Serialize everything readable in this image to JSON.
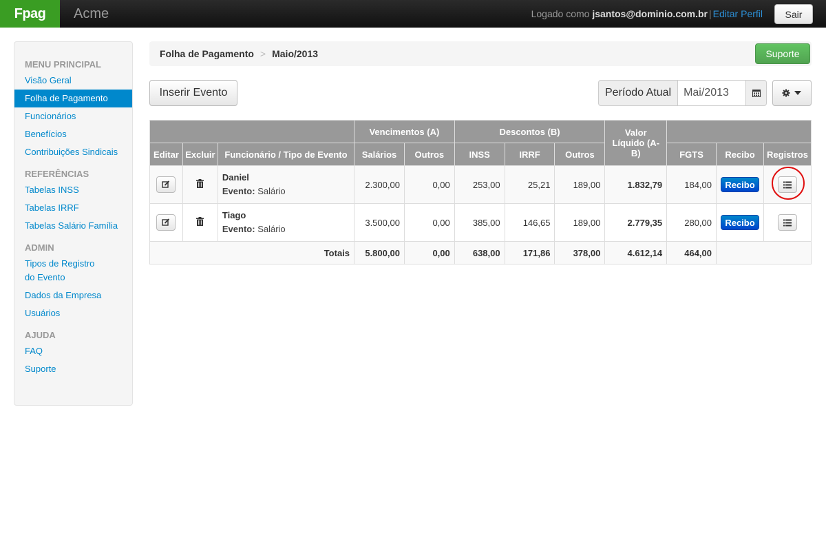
{
  "navbar": {
    "brand": "Fpag",
    "company": "Acme",
    "logged_prefix": "Logado como",
    "user_email": "jsantos@dominio.com.br",
    "separator": "|",
    "edit_profile": "Editar Perfil",
    "logout": "Sair"
  },
  "sidebar": {
    "sections": [
      {
        "header": "MENU PRINCIPAL",
        "items": [
          "Visão Geral",
          "Folha de Pagamento",
          "Funcionários",
          "Benefícios",
          "Contribuições Sindicais"
        ]
      },
      {
        "header": "REFERÊNCIAS",
        "items": [
          "Tabelas INSS",
          "Tabelas IRRF",
          "Tabelas Salário Família"
        ]
      },
      {
        "header": "ADMIN",
        "items": [
          "Tipos de Registro do Evento",
          "Dados da Empresa",
          "Usuários"
        ]
      },
      {
        "header": "AJUDA",
        "items": [
          "FAQ",
          "Suporte"
        ]
      }
    ],
    "active_item": "Folha de Pagamento"
  },
  "breadcrumb": {
    "items": [
      "Folha de Pagamento",
      "Maio/2013"
    ],
    "divider": ">",
    "support_button": "Suporte"
  },
  "toolbar": {
    "insert_event": "Inserir Evento",
    "period_label": "Período Atual",
    "period_value": "Mai/2013"
  },
  "table": {
    "group_headers": {
      "earnings": "Vencimentos (A)",
      "deductions": "Descontos (B)",
      "net": "Valor Líquido (A-B)"
    },
    "columns": {
      "edit": "Editar",
      "delete": "Excluir",
      "employee": "Funcionário / Tipo de Evento",
      "salaries": "Salários",
      "earn_other": "Outros",
      "inss": "INSS",
      "irrf": "IRRF",
      "ded_other": "Outros",
      "fgts": "FGTS",
      "receipt": "Recibo",
      "records": "Registros"
    },
    "event_label": "Evento:",
    "rows": [
      {
        "name": "Daniel",
        "event": "Salário",
        "salaries": "2.300,00",
        "earn_other": "0,00",
        "inss": "253,00",
        "irrf": "25,21",
        "ded_other": "189,00",
        "net": "1.832,79",
        "fgts": "184,00",
        "receipt_btn": "Recibo"
      },
      {
        "name": "Tiago",
        "event": "Salário",
        "salaries": "3.500,00",
        "earn_other": "0,00",
        "inss": "385,00",
        "irrf": "146,65",
        "ded_other": "189,00",
        "net": "2.779,35",
        "fgts": "280,00",
        "receipt_btn": "Recibo"
      }
    ],
    "totals": {
      "label": "Totais",
      "salaries": "5.800,00",
      "earn_other": "0,00",
      "inss": "638,00",
      "irrf": "171,86",
      "ded_other": "378,00",
      "net": "4.612,14",
      "fgts": "464,00"
    }
  },
  "colors": {
    "brand": "#3a9d23",
    "link": "#0088cc",
    "success": "#51a351",
    "primary": "#0044cc",
    "table_header": "#999999",
    "highlight": "#e01010"
  },
  "icons": {
    "edit": "edit-icon",
    "delete": "trash-icon",
    "records": "list-icon",
    "calendar": "calendar-icon",
    "gear": "gear-icon",
    "caret": "caret-down-icon"
  }
}
